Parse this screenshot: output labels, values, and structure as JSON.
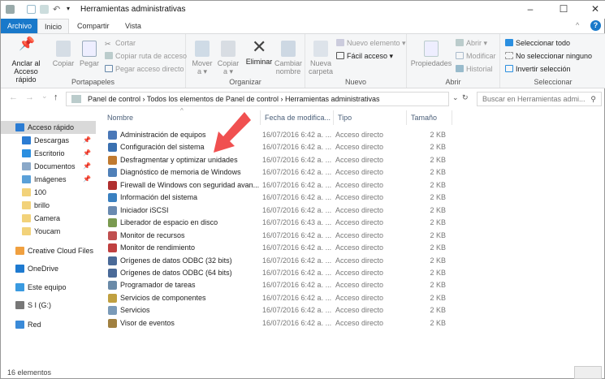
{
  "window": {
    "title": "Herramientas administrativas",
    "minimize": "–",
    "maximize": "☐",
    "close": "✕",
    "help": "?",
    "collapse": "^"
  },
  "tabs": [
    {
      "label": "Archivo"
    },
    {
      "label": "Inicio"
    },
    {
      "label": "Compartir"
    },
    {
      "label": "Vista"
    }
  ],
  "ribbon": {
    "portapapeles": {
      "label": "Portapapeles",
      "pin": "Anclar al Acceso rápido",
      "copy": "Copiar",
      "paste": "Pegar",
      "cut": "Cortar",
      "copy_path": "Copiar ruta de acceso",
      "paste_shortcut": "Pegar acceso directo"
    },
    "organizar": {
      "label": "Organizar",
      "move": "Mover a ▾",
      "copy_to": "Copiar a ▾",
      "delete": "Eliminar",
      "rename": "Cambiar nombre"
    },
    "nuevo": {
      "label": "Nuevo",
      "new_folder": "Nueva carpeta",
      "new_item": "Nuevo elemento ▾",
      "easy_access": "Fácil acceso ▾"
    },
    "abrir": {
      "label": "Abrir",
      "properties": "Propiedades",
      "open": "Abrir ▾",
      "edit": "Modificar",
      "history": "Historial"
    },
    "seleccionar": {
      "label": "Seleccionar",
      "all": "Seleccionar todo",
      "none": "No seleccionar ninguno",
      "invert": "Invertir selección"
    }
  },
  "address": {
    "path": "Panel de control  ›  Todos los elementos de Panel de control  ›  Herramientas administrativas",
    "search_placeholder": "Buscar en Herramientas admi...",
    "back": "←",
    "forward": "→",
    "up": "↑",
    "recent": "⌄",
    "refresh": "↻",
    "dropdown": "⌄"
  },
  "sidebar": [
    {
      "label": "Acceso rápido",
      "color": "#2b7cd3",
      "pinned": false
    },
    {
      "label": "Descargas",
      "color": "#2b7cd3",
      "pinned": true
    },
    {
      "label": "Escritorio",
      "color": "#2b8fe0",
      "pinned": true
    },
    {
      "label": "Documentos",
      "color": "#8aa8c8",
      "pinned": true
    },
    {
      "label": "Imágenes",
      "color": "#5aa0d8",
      "pinned": true
    },
    {
      "label": "100",
      "color": "#f2d27a",
      "pinned": false
    },
    {
      "label": "brillo",
      "color": "#f2d27a",
      "pinned": false
    },
    {
      "label": "Camera",
      "color": "#f2d27a",
      "pinned": false
    },
    {
      "label": "Youcam",
      "color": "#f2d27a",
      "pinned": false
    },
    {
      "label": "Creative Cloud Files",
      "color": "#f0a040",
      "pinned": false
    },
    {
      "label": "OneDrive",
      "color": "#1e7ad0",
      "pinned": false
    },
    {
      "label": "Este equipo",
      "color": "#3a9ae0",
      "pinned": false
    },
    {
      "label": "S I (G:)",
      "color": "#777777",
      "pinned": false
    },
    {
      "label": "Red",
      "color": "#3a8ad8",
      "pinned": false
    }
  ],
  "columns": {
    "name": "Nombre",
    "date": "Fecha de modifica...",
    "type": "Tipo",
    "size": "Tamaño"
  },
  "files": [
    {
      "name": "Administración de equipos",
      "date": "16/07/2016 6:42 a. ...",
      "type": "Acceso directo",
      "size": "2 KB"
    },
    {
      "name": "Configuración del sistema",
      "date": "16/07/2016 6:42 a. ...",
      "type": "Acceso directo",
      "size": "2 KB"
    },
    {
      "name": "Desfragmentar y optimizar unidades",
      "date": "16/07/2016 6:42 a. ...",
      "type": "Acceso directo",
      "size": "2 KB"
    },
    {
      "name": "Diagnóstico de memoria de Windows",
      "date": "16/07/2016 6:42 a. ...",
      "type": "Acceso directo",
      "size": "2 KB"
    },
    {
      "name": "Firewall de Windows con seguridad avan...",
      "date": "16/07/2016 6:42 a. ...",
      "type": "Acceso directo",
      "size": "2 KB"
    },
    {
      "name": "Información del sistema",
      "date": "16/07/2016 6:42 a. ...",
      "type": "Acceso directo",
      "size": "2 KB"
    },
    {
      "name": "Iniciador iSCSI",
      "date": "16/07/2016 6:42 a. ...",
      "type": "Acceso directo",
      "size": "2 KB"
    },
    {
      "name": "Liberador de espacio en disco",
      "date": "16/07/2016 6:43 a. ...",
      "type": "Acceso directo",
      "size": "2 KB"
    },
    {
      "name": "Monitor de recursos",
      "date": "16/07/2016 6:42 a. ...",
      "type": "Acceso directo",
      "size": "2 KB"
    },
    {
      "name": "Monitor de rendimiento",
      "date": "16/07/2016 6:42 a. ...",
      "type": "Acceso directo",
      "size": "2 KB"
    },
    {
      "name": "Orígenes de datos ODBC (32 bits)",
      "date": "16/07/2016 6:42 a. ...",
      "type": "Acceso directo",
      "size": "2 KB"
    },
    {
      "name": "Orígenes de datos ODBC (64 bits)",
      "date": "16/07/2016 6:42 a. ...",
      "type": "Acceso directo",
      "size": "2 KB"
    },
    {
      "name": "Programador de tareas",
      "date": "16/07/2016 6:42 a. ...",
      "type": "Acceso directo",
      "size": "2 KB"
    },
    {
      "name": "Servicios de componentes",
      "date": "16/07/2016 6:42 a. ...",
      "type": "Acceso directo",
      "size": "2 KB"
    },
    {
      "name": "Servicios",
      "date": "16/07/2016 6:42 a. ...",
      "type": "Acceso directo",
      "size": "2 KB"
    },
    {
      "name": "Visor de eventos",
      "date": "16/07/2016 6:42 a. ...",
      "type": "Acceso directo",
      "size": "2 KB"
    }
  ],
  "status": "16 elementos",
  "colors": {
    "accent": "#1979ca",
    "arrow": "#f05050"
  }
}
